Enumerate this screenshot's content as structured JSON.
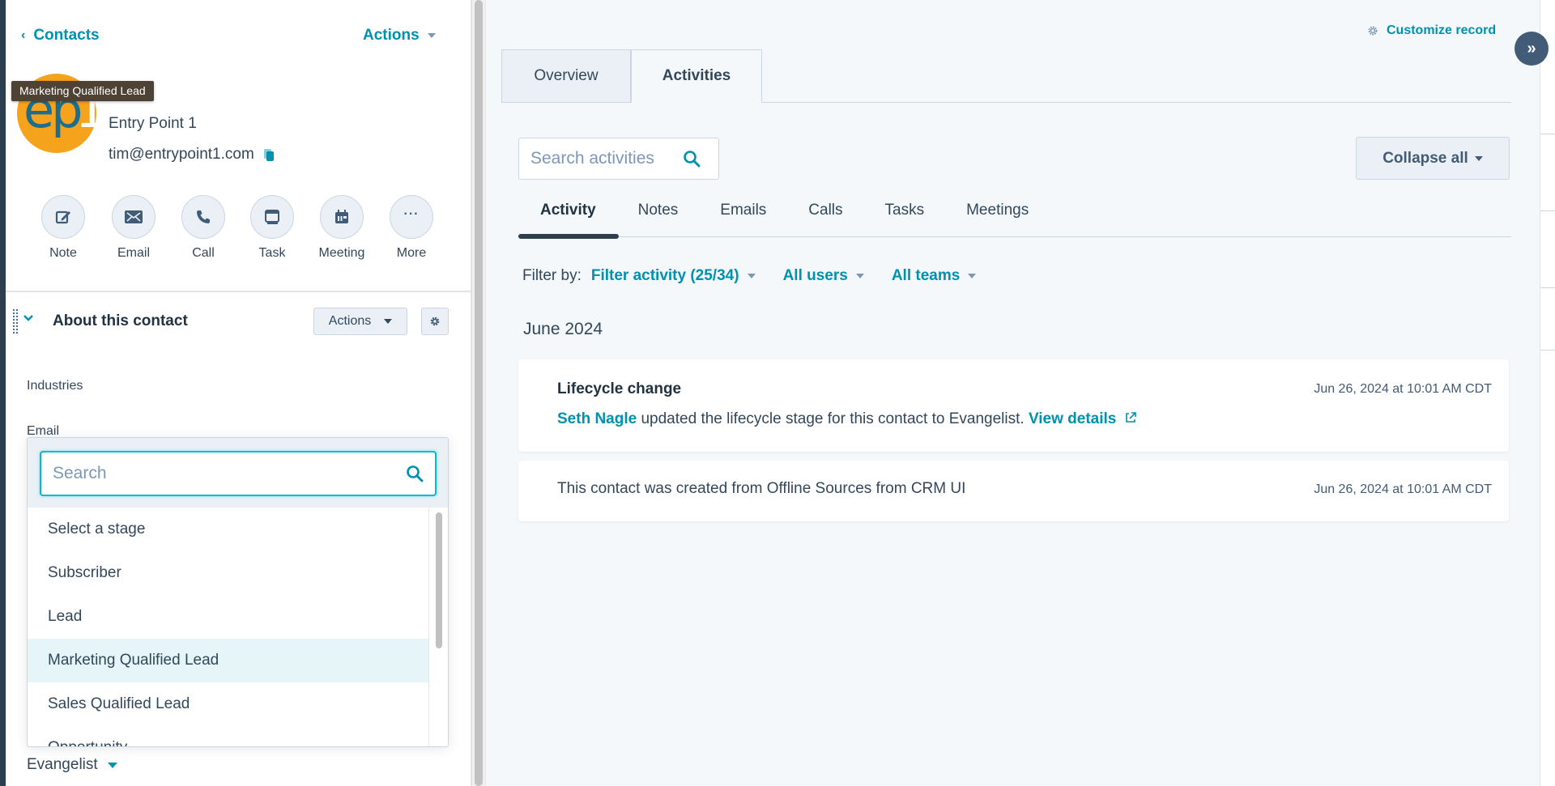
{
  "left_panel": {
    "back_link": "Contacts",
    "actions_label": "Actions",
    "tooltip": "Marketing Qualified Lead",
    "avatar": {
      "text_main": "ep",
      "text_accent": "1",
      "bg_color": "#f5a21c"
    },
    "contact_name": "Entry Point 1",
    "contact_email": "tim@entrypoint1.com",
    "quick_actions": [
      {
        "label": "Note",
        "icon": "note-edit-icon"
      },
      {
        "label": "Email",
        "icon": "envelope-icon"
      },
      {
        "label": "Call",
        "icon": "phone-icon"
      },
      {
        "label": "Task",
        "icon": "task-icon"
      },
      {
        "label": "Meeting",
        "icon": "calendar-icon"
      },
      {
        "label": "More",
        "icon": "more-dots-icon",
        "glyph": "···"
      }
    ],
    "about_section": {
      "title": "About this contact",
      "actions_label": "Actions",
      "fields": {
        "industries_label": "Industries",
        "email_label": "Email"
      }
    },
    "stage_dropdown": {
      "search_placeholder": "Search",
      "options": [
        "Select a stage",
        "Subscriber",
        "Lead",
        "Marketing Qualified Lead",
        "Sales Qualified Lead",
        "Opportunity"
      ],
      "highlighted": "Marketing Qualified Lead",
      "current_value": "Evangelist"
    }
  },
  "right_panel": {
    "customize_label": "Customize record",
    "collapse_sidebar_glyph": "»",
    "tabs": [
      {
        "label": "Overview",
        "active": false
      },
      {
        "label": "Activities",
        "active": true
      }
    ],
    "search_placeholder": "Search activities",
    "collapse_all_label": "Collapse all",
    "subtabs": [
      {
        "label": "Activity",
        "active": true
      },
      {
        "label": "Notes",
        "active": false
      },
      {
        "label": "Emails",
        "active": false
      },
      {
        "label": "Calls",
        "active": false
      },
      {
        "label": "Tasks",
        "active": false
      },
      {
        "label": "Meetings",
        "active": false
      }
    ],
    "filter": {
      "label": "Filter by:",
      "activity": "Filter activity (25/34)",
      "users": "All users",
      "teams": "All teams"
    },
    "month": "June 2024",
    "activities": [
      {
        "title": "Lifecycle change",
        "actor": "Seth Nagle",
        "text": " updated the lifecycle stage for this contact to Evangelist. ",
        "link": "View details",
        "timestamp": "Jun 26, 2024 at 10:01 AM CDT"
      },
      {
        "text": "This contact was created from Offline Sources from CRM UI",
        "timestamp": "Jun 26, 2024 at 10:01 AM CDT"
      }
    ]
  },
  "colors": {
    "accent": "#0091ae",
    "text": "#33475b",
    "heading": "#213343",
    "nav_dark": "#2d3e50",
    "highlight": "#e5f5f8"
  }
}
